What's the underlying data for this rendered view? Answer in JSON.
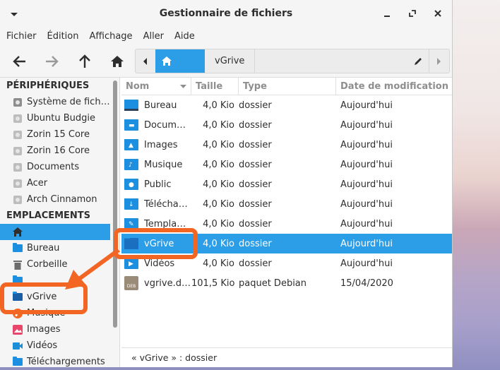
{
  "window": {
    "title": "Gestionnaire de fichiers"
  },
  "menubar": [
    "Fichier",
    "Édition",
    "Affichage",
    "Aller",
    "Aide"
  ],
  "pathbar": {
    "crumb": "vGrive"
  },
  "sidebar": {
    "devices_heading": "PÉRIPHÉRIQUES",
    "devices": [
      {
        "label": "Système de fich…",
        "icon": "system-disk-icon"
      },
      {
        "label": "Ubuntu Budgie",
        "icon": "drive-icon"
      },
      {
        "label": "Zorin 15 Core",
        "icon": "drive-icon"
      },
      {
        "label": "Zorin 16 Core",
        "icon": "drive-icon"
      },
      {
        "label": "Documents",
        "icon": "drive-icon"
      },
      {
        "label": "Acer",
        "icon": "drive-icon"
      },
      {
        "label": "Arch Cinnamon",
        "icon": "drive-icon"
      }
    ],
    "places_heading": "EMPLACEMENTS",
    "places": [
      {
        "label": "",
        "icon": "home-icon",
        "active": true
      },
      {
        "label": "Bureau",
        "icon": "desktop-folder-icon"
      },
      {
        "label": "Corbeille",
        "icon": "trash-icon"
      },
      {
        "label": "",
        "icon": "folder-icon"
      },
      {
        "label": "vGrive",
        "icon": "folder-icon"
      },
      {
        "label": "Musique",
        "icon": "music-icon"
      },
      {
        "label": "Images",
        "icon": "images-icon"
      },
      {
        "label": "Vidéos",
        "icon": "videos-icon"
      },
      {
        "label": "Téléchargements",
        "icon": "download-icon"
      }
    ]
  },
  "filelist": {
    "columns": [
      "Nom",
      "Taille",
      "Type",
      "Date de modification"
    ],
    "rows": [
      {
        "name": "Bureau",
        "size": "4,0 Kio",
        "type": "dossier",
        "date": "Aujourd'hui",
        "icon": "desktop-folder-icon"
      },
      {
        "name": "Docum…",
        "size": "4,0 Kio",
        "type": "dossier",
        "date": "Aujourd'hui",
        "icon": "documents-folder-icon"
      },
      {
        "name": "Images",
        "size": "4,0 Kio",
        "type": "dossier",
        "date": "Aujourd'hui",
        "icon": "images-folder-icon"
      },
      {
        "name": "Musique",
        "size": "4,0 Kio",
        "type": "dossier",
        "date": "Aujourd'hui",
        "icon": "music-folder-icon"
      },
      {
        "name": "Public",
        "size": "4,0 Kio",
        "type": "dossier",
        "date": "Aujourd'hui",
        "icon": "public-folder-icon"
      },
      {
        "name": "Télécha…",
        "size": "4,0 Kio",
        "type": "dossier",
        "date": "Aujourd'hui",
        "icon": "download-folder-icon"
      },
      {
        "name": "Templa…",
        "size": "4,0 Kio",
        "type": "dossier",
        "date": "Aujourd'hui",
        "icon": "templates-folder-icon"
      },
      {
        "name": "vGrive",
        "size": "4,0 Kio",
        "type": "dossier",
        "date": "Aujourd'hui",
        "icon": "folder-icon",
        "selected": true
      },
      {
        "name": "Vidéos",
        "size": "4,0 Kio",
        "type": "dossier",
        "date": "Aujourd'hui",
        "icon": "videos-folder-icon"
      },
      {
        "name": "vgrive.d…",
        "size": "101,5 Kio",
        "type": "paquet Debian",
        "date": "15/04/2020",
        "icon": "deb-package-icon"
      }
    ]
  },
  "statusbar": "« vGrive » : dossier",
  "colors": {
    "accent": "#2c9ee8",
    "annotation": "#f26522"
  }
}
